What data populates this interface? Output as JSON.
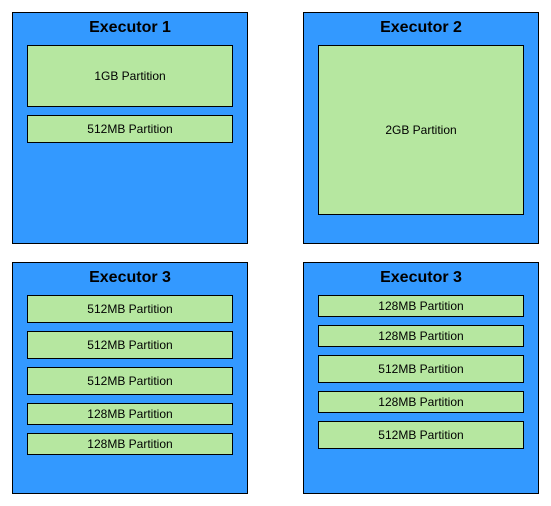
{
  "executors": [
    {
      "title": "Executor 1",
      "partitions": [
        {
          "label": "1GB Partition",
          "sizeClass": "h-1gb"
        },
        {
          "label": "512MB Partition",
          "sizeClass": "h-512"
        }
      ]
    },
    {
      "title": "Executor 2",
      "partitions": [
        {
          "label": "2GB Partition",
          "sizeClass": "h-2gb"
        }
      ]
    },
    {
      "title": "Executor 3",
      "partitions": [
        {
          "label": "512MB Partition",
          "sizeClass": "h-512"
        },
        {
          "label": "512MB Partition",
          "sizeClass": "h-512"
        },
        {
          "label": "512MB Partition",
          "sizeClass": "h-512"
        },
        {
          "label": "128MB Partition",
          "sizeClass": "h-128"
        },
        {
          "label": "128MB Partition",
          "sizeClass": "h-128"
        }
      ]
    },
    {
      "title": "Executor 3",
      "partitions": [
        {
          "label": "128MB Partition",
          "sizeClass": "h-128"
        },
        {
          "label": "128MB Partition",
          "sizeClass": "h-128"
        },
        {
          "label": "512MB Partition",
          "sizeClass": "h-512"
        },
        {
          "label": "128MB Partition",
          "sizeClass": "h-128"
        },
        {
          "label": "512MB Partition",
          "sizeClass": "h-512"
        }
      ]
    }
  ]
}
